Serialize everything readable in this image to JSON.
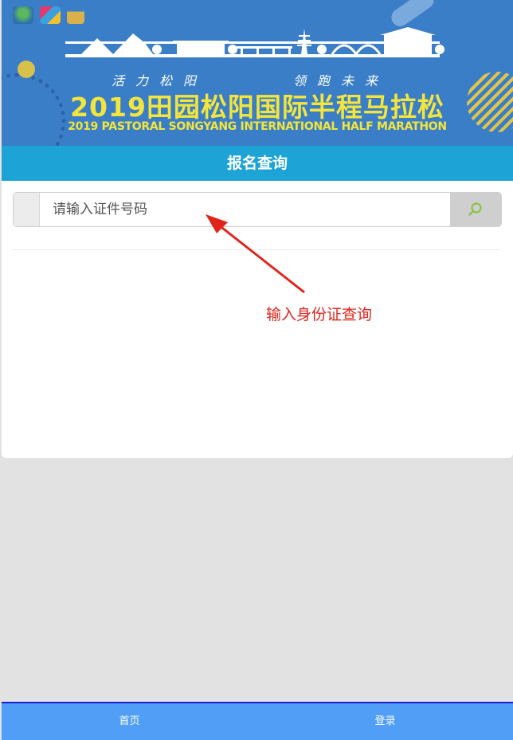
{
  "banner": {
    "slogan_left": "活力松阳",
    "slogan_right": "领跑未来",
    "title": "2019田园松阳国际半程马拉松",
    "subtitle": "2019 PASTORAL SONGYANG INTERNATIONAL HALF MARATHON"
  },
  "page": {
    "title": "报名查询"
  },
  "search": {
    "placeholder": "请输入证件号码",
    "icon": "search-icon"
  },
  "annotation": {
    "text": "输入身份证查询"
  },
  "nav": {
    "items": [
      "首页",
      "登录"
    ]
  },
  "colors": {
    "banner_blue": "#3a7ec8",
    "title_bar": "#1ea3d6",
    "banner_text": "#f3e53c",
    "annotation_red": "#e0241b",
    "nav_blue": "#519ef7"
  }
}
